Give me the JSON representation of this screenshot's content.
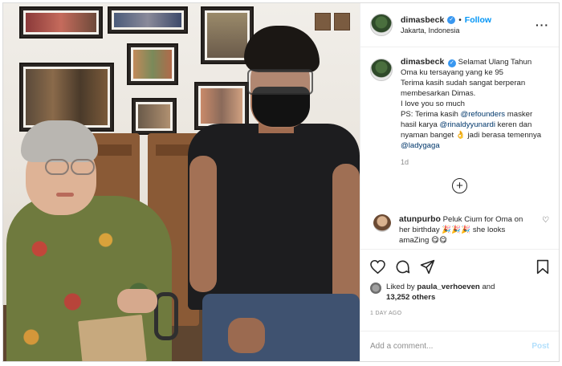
{
  "header": {
    "username": "dimasbeck",
    "follow_label": "Follow",
    "separator": "•",
    "location": "Jakarta, Indonesia",
    "more_label": "···"
  },
  "caption": {
    "username": "dimasbeck",
    "line1": "Selamat Ulang Tahun Oma ku tersayang yang ke 95",
    "line2": "Terima kasih sudah sangat berperan membesarkan Dimas.",
    "line3": "I love you so much",
    "line4_prefix": "PS: Terima kasih ",
    "mention1": "@refounders",
    "line4_mid1": " masker hasil karya ",
    "mention2": "@rinaldyyunardi",
    "line4_mid2": " keren dan nyaman banget 👌 jadi berasa temennya ",
    "mention3": "@ladygaga",
    "time": "1d"
  },
  "more_comments": {
    "label": "+"
  },
  "comment": {
    "username": "atunpurbo",
    "text": "Peluk Cium for Oma on her birthday 🎉🎉🎉 she looks amaZing 😋😋"
  },
  "likes": {
    "prefix": "Liked by ",
    "user": "paula_verhoeven",
    "and": " and",
    "count": "13,252 others"
  },
  "posted_ago": "1 DAY AGO",
  "add_comment": {
    "placeholder": "Add a comment...",
    "post_label": "Post"
  },
  "colors": {
    "accent": "#0095f6",
    "verified": "#3897f0",
    "mention": "#00376b",
    "muted": "#8e8e8e",
    "post_disabled": "#b2dffc"
  }
}
